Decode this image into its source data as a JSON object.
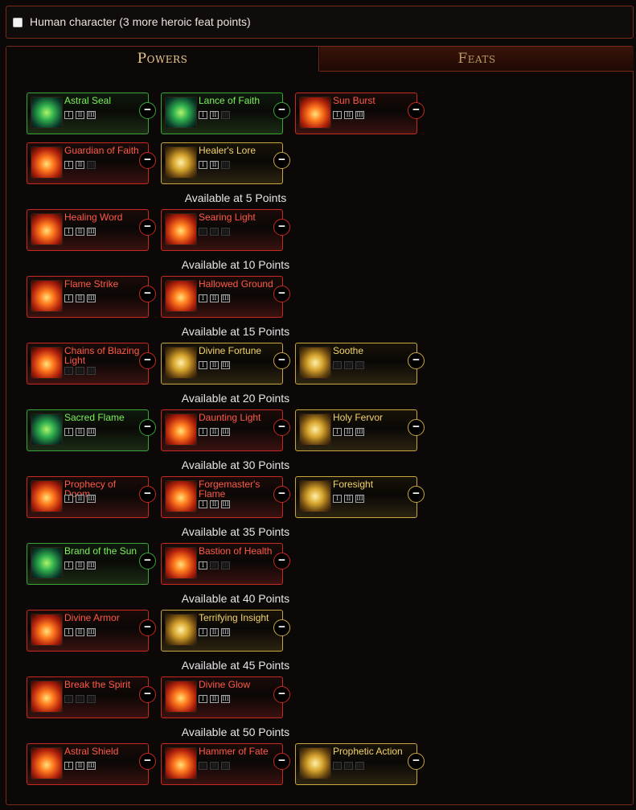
{
  "header": {
    "human_label": "Human character (3 more heroic feat points)",
    "human_checked": false
  },
  "tabs": {
    "powers": "Powers",
    "feats": "Feats"
  },
  "rank_labels": [
    "I",
    "II",
    "III"
  ],
  "remove_label": "−",
  "colors": {
    "green": "#3ba53a",
    "red": "#c62a20",
    "gold": "#c8a640"
  },
  "groups": [
    {
      "header": "",
      "items": [
        {
          "name": "Astral Seal",
          "color": "green",
          "ranks_active": 3,
          "icon": "astral-seal-icon"
        },
        {
          "name": "Lance of Faith",
          "color": "green",
          "ranks_active": 2,
          "icon": "lance-of-faith-icon"
        },
        {
          "name": "Sun Burst",
          "color": "red",
          "ranks_active": 3,
          "icon": "sun-burst-icon"
        },
        {
          "name": "Guardian of Faith",
          "color": "red",
          "ranks_active": 2,
          "icon": "guardian-of-faith-icon"
        },
        {
          "name": "Healer's Lore",
          "color": "gold",
          "ranks_active": 2,
          "icon": "healers-lore-icon"
        }
      ]
    },
    {
      "header": "Available at 5 Points",
      "items": [
        {
          "name": "Healing Word",
          "color": "red",
          "ranks_active": 3,
          "icon": "healing-word-icon"
        },
        {
          "name": "Searing Light",
          "color": "red",
          "ranks_active": 0,
          "icon": "searing-light-icon"
        }
      ]
    },
    {
      "header": "Available at 10 Points",
      "items": [
        {
          "name": "Flame Strike",
          "color": "red",
          "ranks_active": 3,
          "icon": "flame-strike-icon"
        },
        {
          "name": "Hallowed Ground",
          "color": "red",
          "ranks_active": 3,
          "icon": "hallowed-ground-icon"
        }
      ]
    },
    {
      "header": "Available at 15 Points",
      "items": [
        {
          "name": "Chains of Blazing Light",
          "color": "red",
          "ranks_active": 0,
          "icon": "chains-of-blazing-light-icon"
        },
        {
          "name": "Divine Fortune",
          "color": "gold",
          "ranks_active": 3,
          "icon": "divine-fortune-icon"
        },
        {
          "name": "Soothe",
          "color": "gold",
          "ranks_active": 0,
          "icon": "soothe-icon"
        }
      ]
    },
    {
      "header": "Available at 20 Points",
      "items": [
        {
          "name": "Sacred Flame",
          "color": "green",
          "ranks_active": 3,
          "icon": "sacred-flame-icon"
        },
        {
          "name": "Daunting Light",
          "color": "red",
          "ranks_active": 3,
          "icon": "daunting-light-icon"
        },
        {
          "name": "Holy Fervor",
          "color": "gold",
          "ranks_active": 3,
          "icon": "holy-fervor-icon"
        }
      ]
    },
    {
      "header": "Available at 30 Points",
      "items": [
        {
          "name": "Prophecy of Doom",
          "color": "red",
          "ranks_active": 3,
          "icon": "prophecy-of-doom-icon"
        },
        {
          "name": "Forgemaster's Flame",
          "color": "red",
          "ranks_active": 3,
          "icon": "forgemasters-flame-icon"
        },
        {
          "name": "Foresight",
          "color": "gold",
          "ranks_active": 3,
          "icon": "foresight-icon"
        }
      ]
    },
    {
      "header": "Available at 35 Points",
      "items": [
        {
          "name": "Brand of the Sun",
          "color": "green",
          "ranks_active": 3,
          "icon": "brand-of-the-sun-icon"
        },
        {
          "name": "Bastion of Health",
          "color": "red",
          "ranks_active": 1,
          "icon": "bastion-of-health-icon"
        }
      ]
    },
    {
      "header": "Available at 40 Points",
      "items": [
        {
          "name": "Divine Armor",
          "color": "red",
          "ranks_active": 3,
          "icon": "divine-armor-icon"
        },
        {
          "name": "Terrifying Insight",
          "color": "gold",
          "ranks_active": 3,
          "icon": "terrifying-insight-icon"
        }
      ]
    },
    {
      "header": "Available at 45 Points",
      "items": [
        {
          "name": "Break the Spirit",
          "color": "red",
          "ranks_active": 0,
          "icon": "break-the-spirit-icon"
        },
        {
          "name": "Divine Glow",
          "color": "red",
          "ranks_active": 3,
          "icon": "divine-glow-icon"
        }
      ]
    },
    {
      "header": "Available at 50 Points",
      "items": [
        {
          "name": "Astral Shield",
          "color": "red",
          "ranks_active": 3,
          "icon": "astral-shield-icon"
        },
        {
          "name": "Hammer of Fate",
          "color": "red",
          "ranks_active": 0,
          "icon": "hammer-of-fate-icon"
        },
        {
          "name": "Prophetic Action",
          "color": "gold",
          "ranks_active": 0,
          "icon": "prophetic-action-icon"
        }
      ]
    }
  ]
}
